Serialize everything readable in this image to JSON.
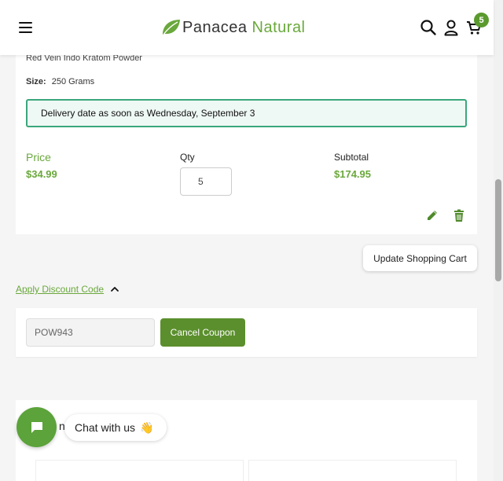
{
  "header": {
    "logo_part1": "Panacea",
    "logo_part2": "Natural",
    "cart_count": "5"
  },
  "item": {
    "name": "Red Vein Indo Kratom Powder",
    "size_label": "Size:",
    "size_value": "250 Grams",
    "delivery_text": "Delivery date as soon as Wednesday, September 3",
    "price_label": "Price",
    "price_value": "$34.99",
    "qty_label": "Qty",
    "qty_value": "5",
    "subtotal_label": "Subtotal",
    "subtotal_value": "$174.95"
  },
  "cart": {
    "update_label": "Update Shopping Cart"
  },
  "discount": {
    "link_label": "Apply Discount Code",
    "coupon_value": "POW943",
    "cancel_label": "Cancel Coupon"
  },
  "section3": {
    "title_fragment": "n"
  },
  "chat": {
    "label": "Chat with us",
    "emoji": "👋"
  },
  "colors": {
    "brand_green": "#6aa83c",
    "button_green": "#5b8f2d",
    "delivery_border": "#3aa77c"
  },
  "icons": [
    "menu-icon",
    "leaf-logo-icon",
    "search-icon",
    "user-icon",
    "cart-icon",
    "edit-icon",
    "trash-icon",
    "chevron-up-icon",
    "chat-icon"
  ]
}
